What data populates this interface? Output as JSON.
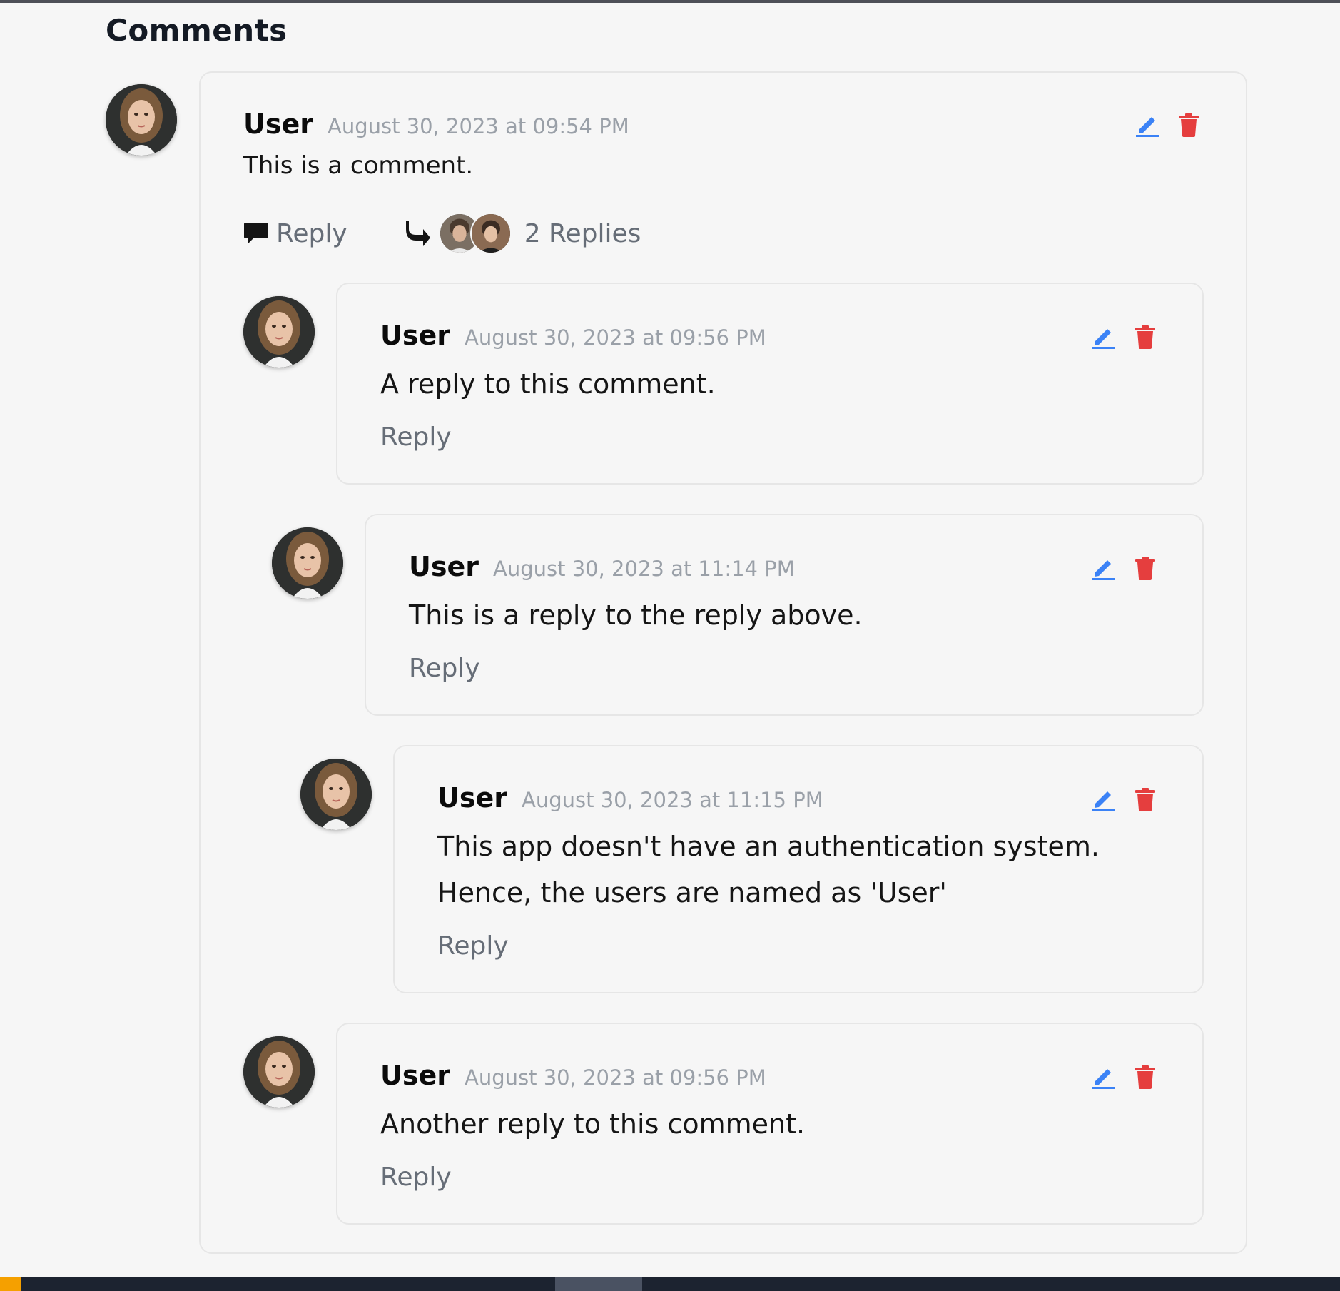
{
  "page": {
    "heading": "Comments"
  },
  "colors": {
    "edit": "#3b82f6",
    "delete": "#e53e3e",
    "muted": "#9aa0a8",
    "link": "#666d77"
  },
  "icons": {
    "edit": "pencil-icon",
    "delete": "trash-icon",
    "reply": "speech-bubble-icon",
    "thread": "reply-arrow-icon"
  },
  "comment": {
    "author": "User",
    "date": "August 30, 2023 at 09:54 PM",
    "text": "This is a comment.",
    "reply_label": "Reply",
    "replies_label": "2 Replies",
    "replies": [
      {
        "author": "User",
        "date": "August 30, 2023 at 09:56 PM",
        "text": "A reply to this comment.",
        "reply_label": "Reply",
        "replies": [
          {
            "author": "User",
            "date": "August 30, 2023 at 11:14 PM",
            "text": "This is a reply to the reply above.",
            "reply_label": "Reply",
            "replies": [
              {
                "author": "User",
                "date": "August 30, 2023 at 11:15 PM",
                "text": "This app doesn't have an authentication system. Hence, the users are named as 'User'",
                "reply_label": "Reply"
              }
            ]
          }
        ]
      },
      {
        "author": "User",
        "date": "August 30, 2023 at 09:56 PM",
        "text": "Another reply to this comment.",
        "reply_label": "Reply"
      }
    ]
  }
}
